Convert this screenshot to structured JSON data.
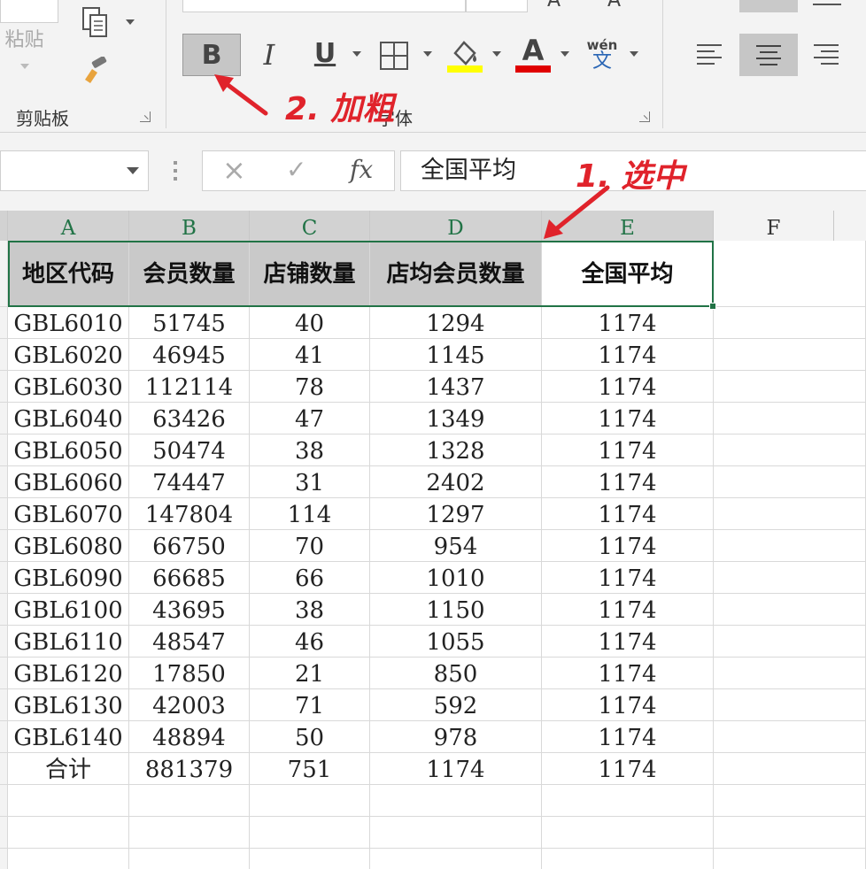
{
  "ribbon": {
    "paste_label": "粘贴",
    "clipboard_group": "剪贴板",
    "font_group": "字体",
    "bold_label": "B",
    "italic_label": "I",
    "underline_label": "U",
    "font_color_label": "A",
    "phonetic_top": "wén",
    "phonetic_bottom": "文",
    "colors": {
      "highlight": "#ffff00",
      "font_color": "#e00000",
      "accent": "#217346"
    }
  },
  "formula_bar": {
    "cancel_icon": "×",
    "enter_icon": "✓",
    "fx_label": "fx",
    "content": "全国平均"
  },
  "annotations": {
    "step1": "1. 选中",
    "step2": "2. 加粗"
  },
  "sheet": {
    "columns": [
      "A",
      "B",
      "C",
      "D",
      "E",
      "F"
    ],
    "header_row": [
      "地区代码",
      "会员数量",
      "店铺数量",
      "店均会员数量",
      "全国平均"
    ],
    "rows": [
      [
        "GBL6010",
        "51745",
        "40",
        "1294",
        "1174"
      ],
      [
        "GBL6020",
        "46945",
        "41",
        "1145",
        "1174"
      ],
      [
        "GBL6030",
        "112114",
        "78",
        "1437",
        "1174"
      ],
      [
        "GBL6040",
        "63426",
        "47",
        "1349",
        "1174"
      ],
      [
        "GBL6050",
        "50474",
        "38",
        "1328",
        "1174"
      ],
      [
        "GBL6060",
        "74447",
        "31",
        "2402",
        "1174"
      ],
      [
        "GBL6070",
        "147804",
        "114",
        "1297",
        "1174"
      ],
      [
        "GBL6080",
        "66750",
        "70",
        "954",
        "1174"
      ],
      [
        "GBL6090",
        "66685",
        "66",
        "1010",
        "1174"
      ],
      [
        "GBL6100",
        "43695",
        "38",
        "1150",
        "1174"
      ],
      [
        "GBL6110",
        "48547",
        "46",
        "1055",
        "1174"
      ],
      [
        "GBL6120",
        "17850",
        "21",
        "850",
        "1174"
      ],
      [
        "GBL6130",
        "42003",
        "71",
        "592",
        "1174"
      ],
      [
        "GBL6140",
        "48894",
        "50",
        "978",
        "1174"
      ],
      [
        "合计",
        "881379",
        "751",
        "1174",
        "1174"
      ]
    ]
  }
}
